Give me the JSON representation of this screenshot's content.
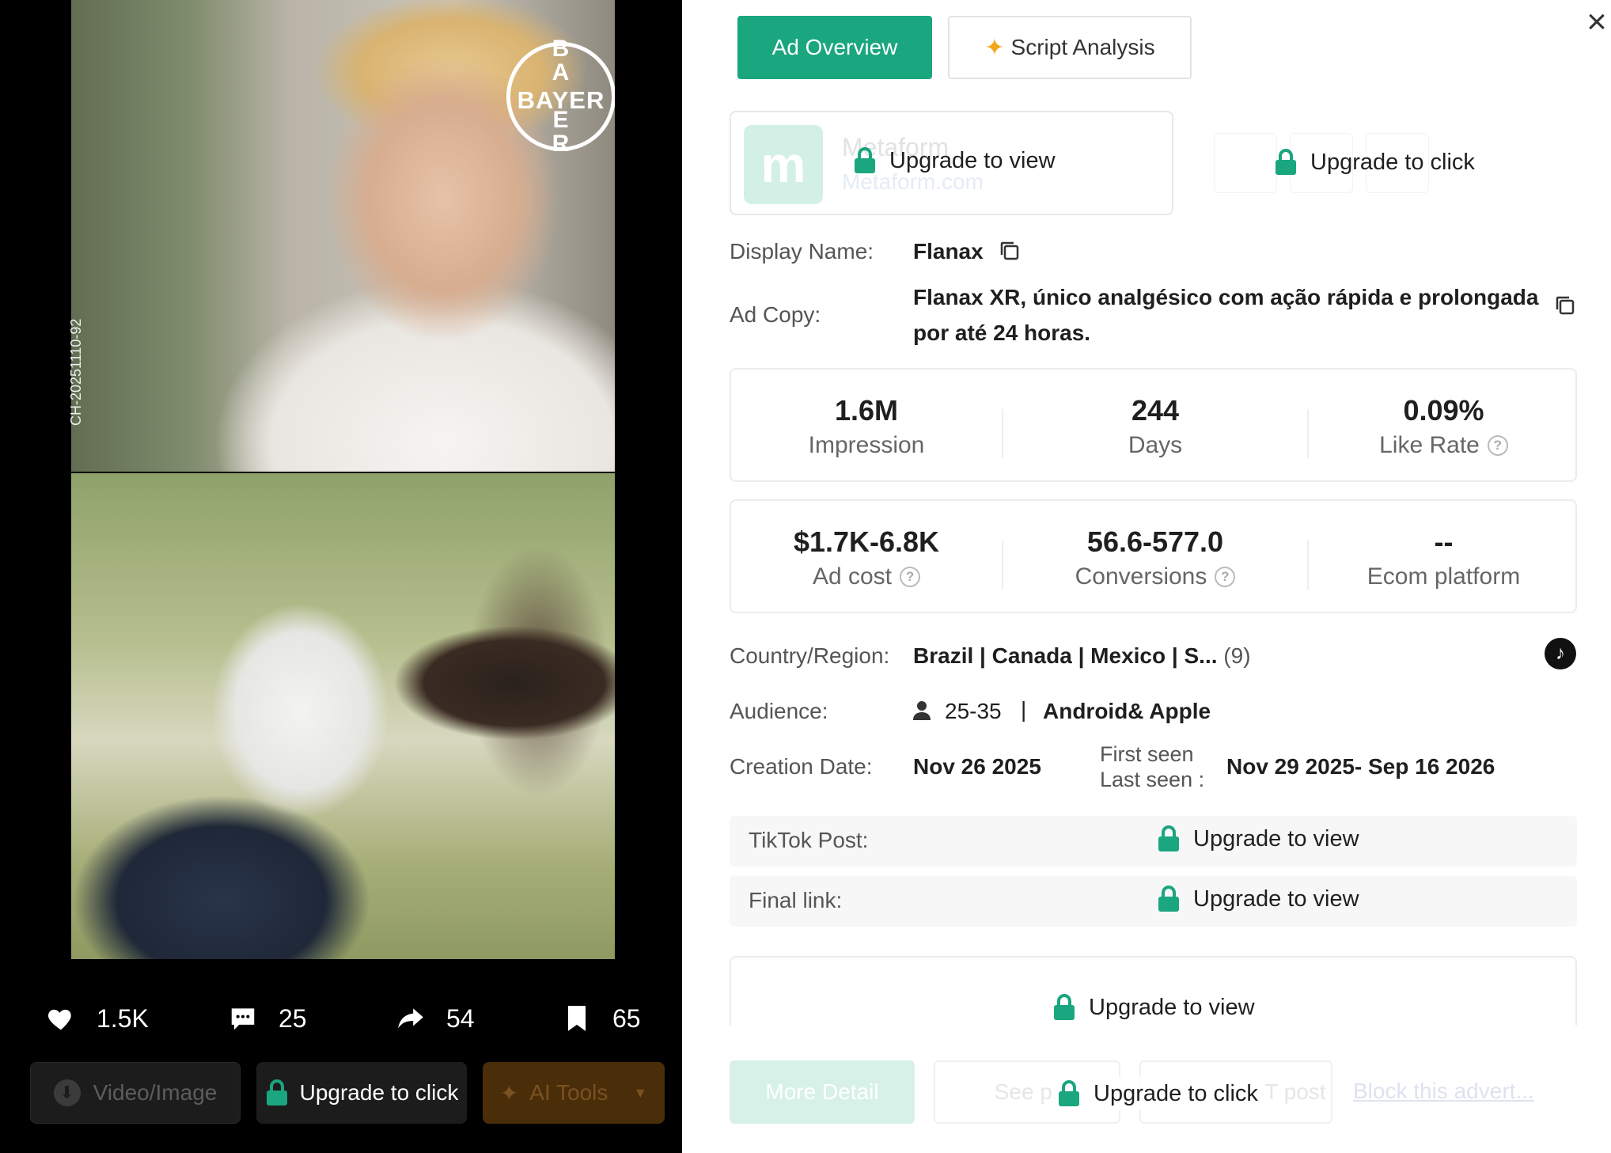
{
  "media": {
    "brand_logo": "BAYER",
    "side_code": "CH-20251110-92",
    "colors": {
      "accent": "#1aa67f"
    }
  },
  "engagement": {
    "likes": "1.5K",
    "comments": "25",
    "shares": "54",
    "saves": "65"
  },
  "left_actions": {
    "download_label": "Video/Image",
    "upgrade_label": "Upgrade to click",
    "ai_tools_label": "AI Tools"
  },
  "tabs": {
    "ad_overview": "Ad Overview",
    "script_analysis": "Script Analysis"
  },
  "advertiser": {
    "name": "Metaform",
    "url": "Metaform.com",
    "logo_text": "m",
    "upgrade_view": "Upgrade to view",
    "upgrade_click": "Upgrade to click"
  },
  "details": {
    "display_name_label": "Display Name:",
    "display_name": "Flanax",
    "ad_copy_label": "Ad Copy:",
    "ad_copy_line1": "Flanax XR, único analgésico com ação rápida e prolongada",
    "ad_copy_line2": "por até 24 horas."
  },
  "metrics_row1": [
    {
      "value": "1.6M",
      "label": "Impression"
    },
    {
      "value": "244",
      "label": "Days"
    },
    {
      "value": "0.09%",
      "label": "Like Rate"
    }
  ],
  "metrics_row2": [
    {
      "value": "$1.7K-6.8K",
      "label": "Ad cost"
    },
    {
      "value": "56.6-577.0",
      "label": "Conversions"
    },
    {
      "value": "--",
      "label": "Ecom platform"
    }
  ],
  "info": {
    "country_label": "Country/Region:",
    "country_value": "Brazil | Canada | Mexico | S...",
    "country_count": "(9)",
    "audience_label": "Audience:",
    "audience_age": "25-35",
    "audience_divider": "|",
    "audience_device": "Android& Apple",
    "creation_label": "Creation Date:",
    "creation_value": "Nov 26 2025",
    "first_seen_label": "First seen",
    "last_seen_label": "Last seen :",
    "seen_range": "Nov 29 2025- Sep 16 2026"
  },
  "links": {
    "tiktok_post_label": "TikTok Post:",
    "final_link_label": "Final link:",
    "upgrade_view": "Upgrade to view"
  },
  "bottom": {
    "upgrade_view": "Upgrade to view",
    "upgrade_click": "Upgrade to click",
    "more_detail": "More Detail",
    "see_preview": "See pr",
    "tiktok_post": "T post",
    "block": "Block this advert..."
  }
}
